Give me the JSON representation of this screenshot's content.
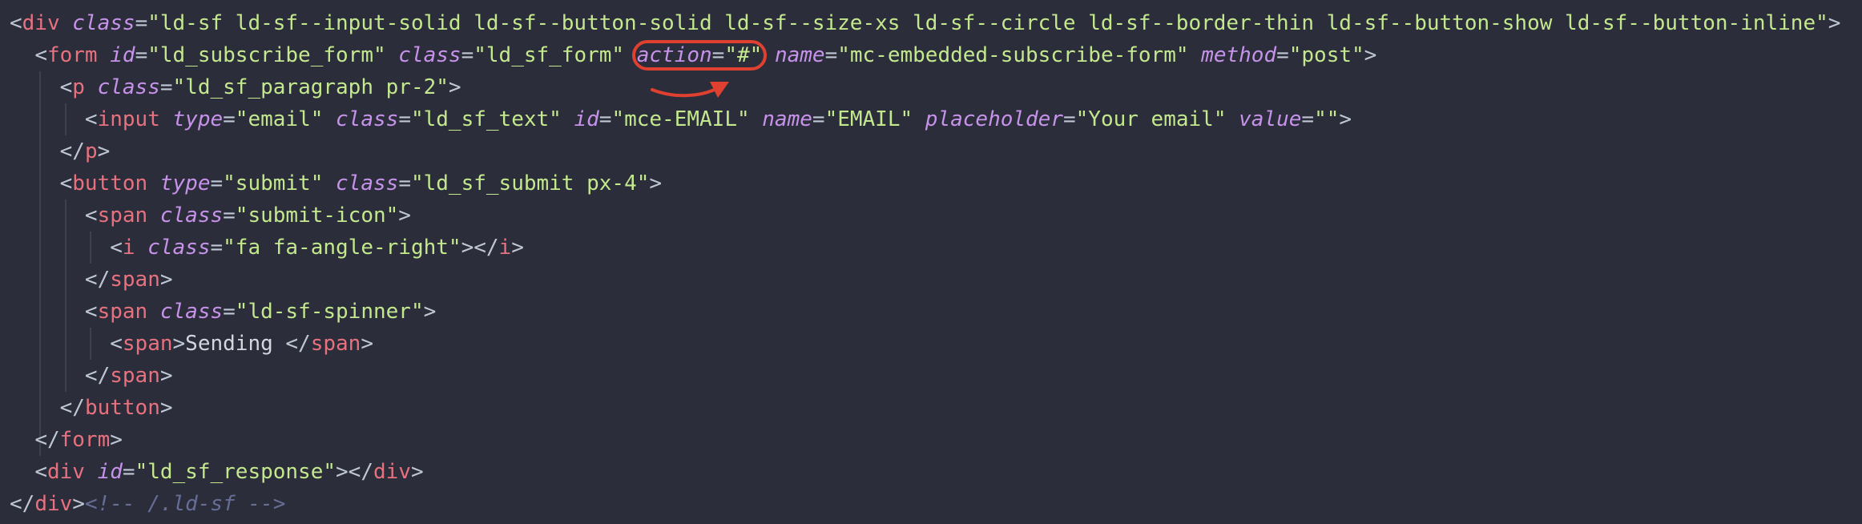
{
  "editor": {
    "lines": [
      [
        {
          "t": "punc",
          "v": "<"
        },
        {
          "t": "tag",
          "v": "div"
        },
        {
          "t": "text",
          "v": " "
        },
        {
          "t": "attr",
          "v": "class"
        },
        {
          "t": "punc",
          "v": "="
        },
        {
          "t": "str",
          "v": "\"ld-sf ld-sf--input-solid ld-sf--button-solid ld-sf--size-xs ld-sf--circle ld-sf--border-thin ld-sf--button-show ld-sf--button-inline\""
        },
        {
          "t": "punc",
          "v": ">"
        }
      ],
      [
        {
          "t": "text",
          "v": "  "
        },
        {
          "t": "punc",
          "v": "<"
        },
        {
          "t": "tag",
          "v": "form"
        },
        {
          "t": "text",
          "v": " "
        },
        {
          "t": "attr",
          "v": "id"
        },
        {
          "t": "punc",
          "v": "="
        },
        {
          "t": "str",
          "v": "\"ld_subscribe_form\""
        },
        {
          "t": "text",
          "v": " "
        },
        {
          "t": "attr",
          "v": "class"
        },
        {
          "t": "punc",
          "v": "="
        },
        {
          "t": "str",
          "v": "\"ld_sf_form\""
        },
        {
          "t": "text",
          "v": " "
        },
        {
          "t": "hl-start"
        },
        {
          "t": "attr",
          "v": "action"
        },
        {
          "t": "punc",
          "v": "="
        },
        {
          "t": "str",
          "v": "\"#\""
        },
        {
          "t": "hl-end"
        },
        {
          "t": "text",
          "v": " "
        },
        {
          "t": "attr",
          "v": "name"
        },
        {
          "t": "punc",
          "v": "="
        },
        {
          "t": "str",
          "v": "\"mc-embedded-subscribe-form\""
        },
        {
          "t": "text",
          "v": " "
        },
        {
          "t": "attr",
          "v": "method"
        },
        {
          "t": "punc",
          "v": "="
        },
        {
          "t": "str",
          "v": "\"post\""
        },
        {
          "t": "punc",
          "v": ">"
        }
      ],
      [
        {
          "t": "text",
          "v": "    "
        },
        {
          "t": "punc",
          "v": "<"
        },
        {
          "t": "tag",
          "v": "p"
        },
        {
          "t": "text",
          "v": " "
        },
        {
          "t": "attr",
          "v": "class"
        },
        {
          "t": "punc",
          "v": "="
        },
        {
          "t": "str",
          "v": "\"ld_sf_paragraph pr-2\""
        },
        {
          "t": "punc",
          "v": ">"
        }
      ],
      [
        {
          "t": "text",
          "v": "      "
        },
        {
          "t": "punc",
          "v": "<"
        },
        {
          "t": "tag",
          "v": "input"
        },
        {
          "t": "text",
          "v": " "
        },
        {
          "t": "attr",
          "v": "type"
        },
        {
          "t": "punc",
          "v": "="
        },
        {
          "t": "str",
          "v": "\"email\""
        },
        {
          "t": "text",
          "v": " "
        },
        {
          "t": "attr",
          "v": "class"
        },
        {
          "t": "punc",
          "v": "="
        },
        {
          "t": "str",
          "v": "\"ld_sf_text\""
        },
        {
          "t": "text",
          "v": " "
        },
        {
          "t": "attr",
          "v": "id"
        },
        {
          "t": "punc",
          "v": "="
        },
        {
          "t": "str",
          "v": "\"mce-EMAIL\""
        },
        {
          "t": "text",
          "v": " "
        },
        {
          "t": "attr",
          "v": "name"
        },
        {
          "t": "punc",
          "v": "="
        },
        {
          "t": "str",
          "v": "\"EMAIL\""
        },
        {
          "t": "text",
          "v": " "
        },
        {
          "t": "attr",
          "v": "placeholder"
        },
        {
          "t": "punc",
          "v": "="
        },
        {
          "t": "str",
          "v": "\"Your email\""
        },
        {
          "t": "text",
          "v": " "
        },
        {
          "t": "attr",
          "v": "value"
        },
        {
          "t": "punc",
          "v": "="
        },
        {
          "t": "str",
          "v": "\"\""
        },
        {
          "t": "punc",
          "v": ">"
        }
      ],
      [
        {
          "t": "text",
          "v": "    "
        },
        {
          "t": "punc",
          "v": "</"
        },
        {
          "t": "tag",
          "v": "p"
        },
        {
          "t": "punc",
          "v": ">"
        }
      ],
      [
        {
          "t": "text",
          "v": "    "
        },
        {
          "t": "punc",
          "v": "<"
        },
        {
          "t": "tag",
          "v": "button"
        },
        {
          "t": "text",
          "v": " "
        },
        {
          "t": "attr",
          "v": "type"
        },
        {
          "t": "punc",
          "v": "="
        },
        {
          "t": "str",
          "v": "\"submit\""
        },
        {
          "t": "text",
          "v": " "
        },
        {
          "t": "attr",
          "v": "class"
        },
        {
          "t": "punc",
          "v": "="
        },
        {
          "t": "str",
          "v": "\"ld_sf_submit px-4\""
        },
        {
          "t": "punc",
          "v": ">"
        }
      ],
      [
        {
          "t": "text",
          "v": "      "
        },
        {
          "t": "punc",
          "v": "<"
        },
        {
          "t": "tag",
          "v": "span"
        },
        {
          "t": "text",
          "v": " "
        },
        {
          "t": "attr",
          "v": "class"
        },
        {
          "t": "punc",
          "v": "="
        },
        {
          "t": "str",
          "v": "\"submit-icon\""
        },
        {
          "t": "punc",
          "v": ">"
        }
      ],
      [
        {
          "t": "text",
          "v": "        "
        },
        {
          "t": "punc",
          "v": "<"
        },
        {
          "t": "tag",
          "v": "i"
        },
        {
          "t": "text",
          "v": " "
        },
        {
          "t": "attr",
          "v": "class"
        },
        {
          "t": "punc",
          "v": "="
        },
        {
          "t": "str",
          "v": "\"fa fa-angle-right\""
        },
        {
          "t": "punc",
          "v": "></"
        },
        {
          "t": "tag",
          "v": "i"
        },
        {
          "t": "punc",
          "v": ">"
        }
      ],
      [
        {
          "t": "text",
          "v": "      "
        },
        {
          "t": "punc",
          "v": "</"
        },
        {
          "t": "tag",
          "v": "span"
        },
        {
          "t": "punc",
          "v": ">"
        }
      ],
      [
        {
          "t": "text",
          "v": "      "
        },
        {
          "t": "punc",
          "v": "<"
        },
        {
          "t": "tag",
          "v": "span"
        },
        {
          "t": "text",
          "v": " "
        },
        {
          "t": "attr",
          "v": "class"
        },
        {
          "t": "punc",
          "v": "="
        },
        {
          "t": "str",
          "v": "\"ld-sf-spinner\""
        },
        {
          "t": "punc",
          "v": ">"
        }
      ],
      [
        {
          "t": "text",
          "v": "        "
        },
        {
          "t": "punc",
          "v": "<"
        },
        {
          "t": "tag",
          "v": "span"
        },
        {
          "t": "punc",
          "v": ">"
        },
        {
          "t": "text",
          "v": "Sending "
        },
        {
          "t": "punc",
          "v": "</"
        },
        {
          "t": "tag",
          "v": "span"
        },
        {
          "t": "punc",
          "v": ">"
        }
      ],
      [
        {
          "t": "text",
          "v": "      "
        },
        {
          "t": "punc",
          "v": "</"
        },
        {
          "t": "tag",
          "v": "span"
        },
        {
          "t": "punc",
          "v": ">"
        }
      ],
      [
        {
          "t": "text",
          "v": "    "
        },
        {
          "t": "punc",
          "v": "</"
        },
        {
          "t": "tag",
          "v": "button"
        },
        {
          "t": "punc",
          "v": ">"
        }
      ],
      [
        {
          "t": "text",
          "v": "  "
        },
        {
          "t": "punc",
          "v": "</"
        },
        {
          "t": "tag",
          "v": "form"
        },
        {
          "t": "punc",
          "v": ">"
        }
      ],
      [
        {
          "t": "text",
          "v": "  "
        },
        {
          "t": "punc",
          "v": "<"
        },
        {
          "t": "tag",
          "v": "div"
        },
        {
          "t": "text",
          "v": " "
        },
        {
          "t": "attr",
          "v": "id"
        },
        {
          "t": "punc",
          "v": "="
        },
        {
          "t": "str",
          "v": "\"ld_sf_response\""
        },
        {
          "t": "punc",
          "v": "></"
        },
        {
          "t": "tag",
          "v": "div"
        },
        {
          "t": "punc",
          "v": ">"
        }
      ],
      [
        {
          "t": "punc",
          "v": "</"
        },
        {
          "t": "tag",
          "v": "div"
        },
        {
          "t": "punc",
          "v": ">"
        },
        {
          "t": "cmt",
          "v": "<!-- /.ld-sf -->"
        }
      ]
    ]
  },
  "colors": {
    "background": "#2b2d3a",
    "tag": "#e8717f",
    "attribute": "#c792ea",
    "string": "#c3e88d",
    "punctuation": "#bfc7d5",
    "comment": "#676e95",
    "annotation": "#e0402f"
  }
}
